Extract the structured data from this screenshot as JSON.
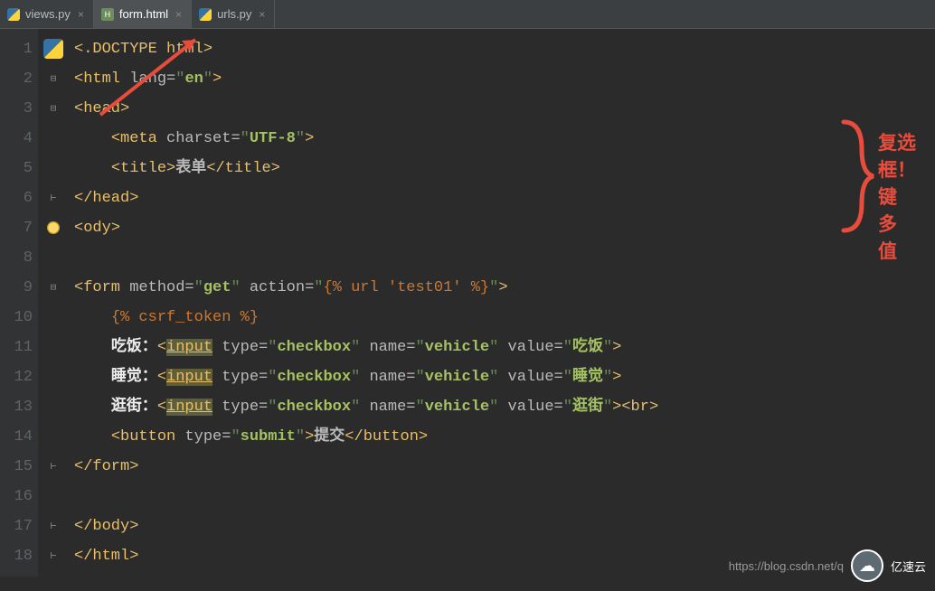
{
  "tabs": {
    "t0": {
      "label": "views.py"
    },
    "t1": {
      "label": "form.html"
    },
    "t2": {
      "label": "urls.py"
    }
  },
  "lines": {
    "n1": "1",
    "n2": "2",
    "n3": "3",
    "n4": "4",
    "n5": "5",
    "n6": "6",
    "n7": "7",
    "n8": "8",
    "n9": "9",
    "n10": "10",
    "n11": "11",
    "n12": "12",
    "n13": "13",
    "n14": "14",
    "n15": "15",
    "n16": "16",
    "n17": "17",
    "n18": "18"
  },
  "code": {
    "l1": {
      "doctype1": "<",
      "doctype2": ".DOCTYPE ",
      "doctype3": "html",
      "doctype4": ">"
    },
    "l2": {
      "open": "<",
      "tag": "html ",
      "attr": "lang=",
      "q1": "\"",
      "val": "en",
      "q2": "\"",
      "close": ">"
    },
    "l3": {
      "open": "<",
      "tag": "head",
      "close": ">"
    },
    "l4": {
      "open": "<",
      "tag": "meta ",
      "attr": "charset=",
      "q1": "\"",
      "val": "UTF-8",
      "q2": "\"",
      "close": ">"
    },
    "l5": {
      "open": "<",
      "tag": "title",
      "close": ">",
      "text": "表单",
      "open2": "</",
      "tag2": "title",
      "close2": ">"
    },
    "l6": {
      "open": "</",
      "tag": "head",
      "close": ">"
    },
    "l7": {
      "open": "<",
      "tag": "ody",
      "close": ">"
    },
    "l9": {
      "open": "<",
      "tag": "form ",
      "attr1": "method=",
      "val1": "get",
      "attr2": " action=",
      "tmpl": "{% url 'test01' %}",
      "close": ">"
    },
    "l10": {
      "tmpl": "{% csrf_token %}"
    },
    "l11": {
      "label": "吃饭：",
      "open": "<",
      "input": "input",
      "attr1": " type=",
      "val1": "checkbox",
      "attr2": " name=",
      "val2": "vehicle",
      "attr3": " value=",
      "val3": "吃饭",
      "close": ">"
    },
    "l12": {
      "label": "睡觉：",
      "open": "<",
      "input": "input",
      "attr1": " type=",
      "val1": "checkbox",
      "attr2": " name=",
      "val2": "vehicle",
      "attr3": " value=",
      "val3": "睡觉",
      "close": ">"
    },
    "l13": {
      "label": "逛街：",
      "open": "<",
      "input": "input",
      "attr1": " type=",
      "val1": "checkbox",
      "attr2": " name=",
      "val2": "vehicle",
      "attr3": " value=",
      "val3": "逛街",
      "close": ">",
      "br": "<br>"
    },
    "l14": {
      "open": "<",
      "tag": "button ",
      "attr": "type=",
      "val": "submit",
      "close": ">",
      "text": "提交",
      "open2": "</",
      "tag2": "button",
      "close2": ">"
    },
    "l15": {
      "open": "</",
      "tag": "form",
      "close": ">"
    },
    "l17": {
      "open": "</",
      "tag": "body",
      "close": ">"
    },
    "l18": {
      "open": "</",
      "tag": "html",
      "close": ">"
    }
  },
  "annotation": {
    "line1": "复选框！",
    "line2": "一键多值"
  },
  "watermark": {
    "text": "https://blog.csdn.net/q",
    "brand": "亿速云"
  }
}
